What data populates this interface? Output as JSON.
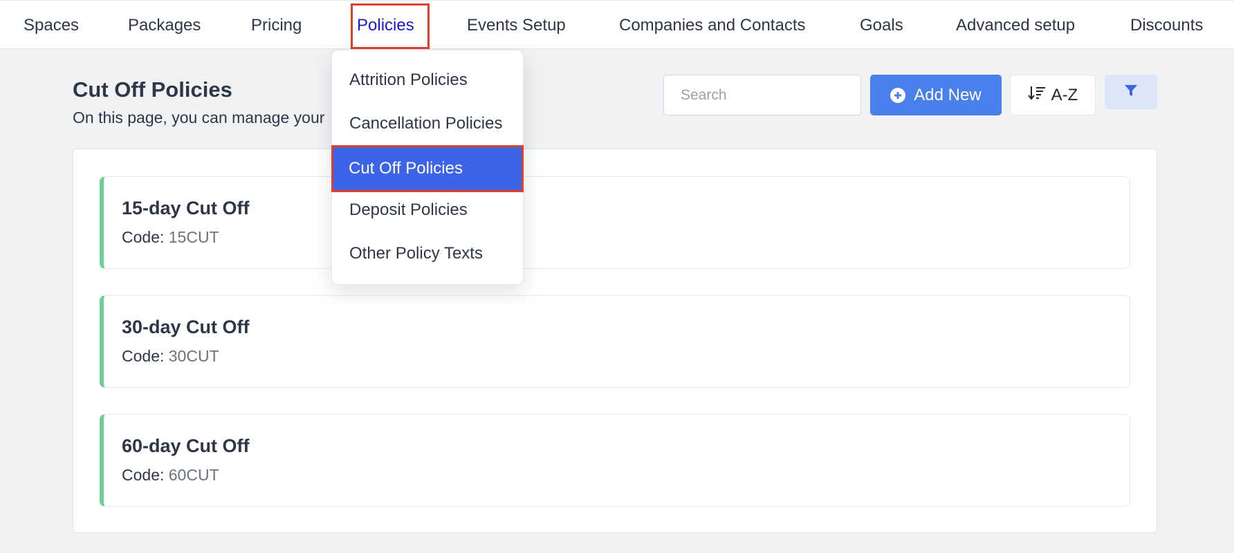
{
  "nav": {
    "items": [
      {
        "label": "Spaces"
      },
      {
        "label": "Packages"
      },
      {
        "label": "Pricing"
      },
      {
        "label": "Policies",
        "active": true
      },
      {
        "label": "Events Setup"
      },
      {
        "label": "Companies and Contacts"
      },
      {
        "label": "Goals"
      },
      {
        "label": "Advanced setup"
      },
      {
        "label": "Discounts"
      }
    ],
    "active_color": "#1a1ad6"
  },
  "dropdown": {
    "items": [
      {
        "label": "Attrition Policies"
      },
      {
        "label": "Cancellation Policies"
      },
      {
        "label": "Cut Off Policies",
        "selected": true
      },
      {
        "label": "Deposit Policies"
      },
      {
        "label": "Other Policy Texts"
      }
    ],
    "selected_color": "#3d63e8",
    "highlight_color": "#e0402a"
  },
  "header": {
    "title": "Cut Off Policies",
    "subtitle": "On this page, you can manage your"
  },
  "toolbar": {
    "search_placeholder": "Search",
    "add_label": "Add New",
    "sort_label": "A-Z",
    "add_icon": "plus-circle-icon",
    "sort_icon": "sort-descending-icon",
    "filter_icon": "funnel-icon",
    "accent": "#4a80ec"
  },
  "policies": [
    {
      "name": "15-day Cut Off",
      "code_label": "Code:",
      "code": "15CUT"
    },
    {
      "name": "30-day Cut Off",
      "code_label": "Code:",
      "code": "30CUT"
    },
    {
      "name": "60-day Cut Off",
      "code_label": "Code:",
      "code": "60CUT"
    }
  ],
  "card_accent": "#6fcf97"
}
